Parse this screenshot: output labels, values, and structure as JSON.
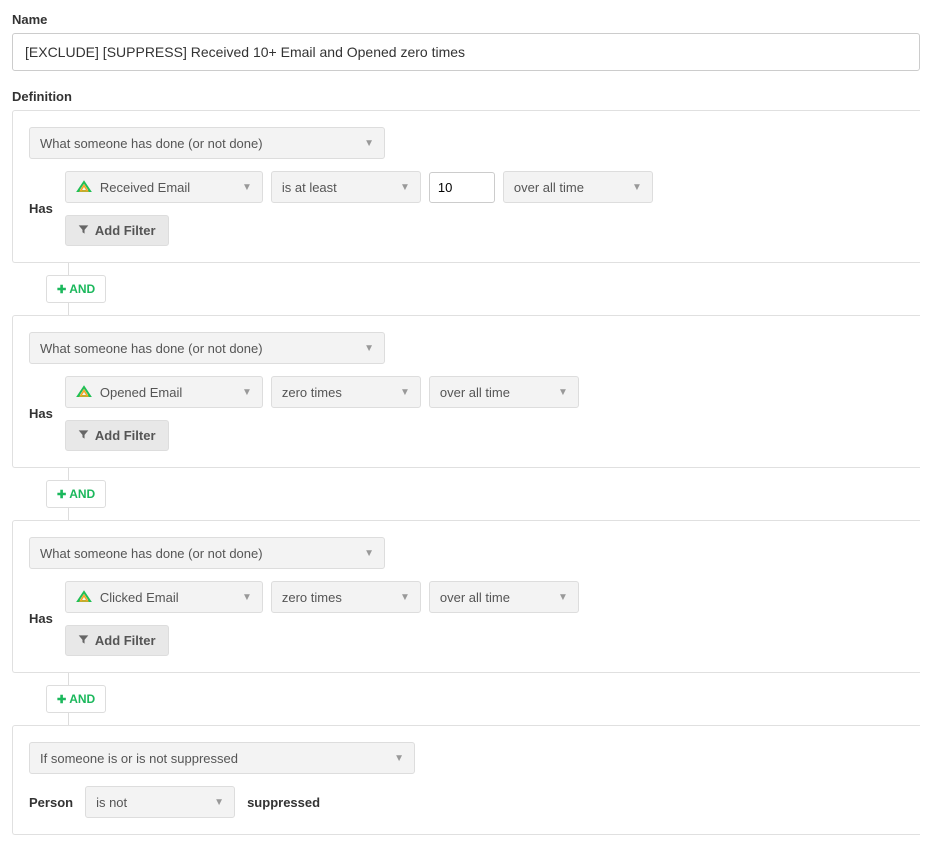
{
  "labels": {
    "name": "Name",
    "definition": "Definition",
    "has": "Has",
    "person": "Person",
    "suppressed": "suppressed",
    "and": "AND",
    "addFilter": "Add Filter"
  },
  "nameValue": "[EXCLUDE] [SUPPRESS] Received 10+ Email and Opened zero times",
  "blocks": [
    {
      "type": "What someone has done (or not done)",
      "event": "Received Email",
      "operator": "is at least",
      "count": "10",
      "time": "over all time",
      "hasCount": true
    },
    {
      "type": "What someone has done (or not done)",
      "event": "Opened Email",
      "operator": "zero times",
      "count": "",
      "time": "over all time",
      "hasCount": false
    },
    {
      "type": "What someone has done (or not done)",
      "event": "Clicked Email",
      "operator": "zero times",
      "count": "",
      "time": "over all time",
      "hasCount": false
    }
  ],
  "suppressBlock": {
    "type": "If someone is or is not suppressed",
    "op": "is not"
  }
}
